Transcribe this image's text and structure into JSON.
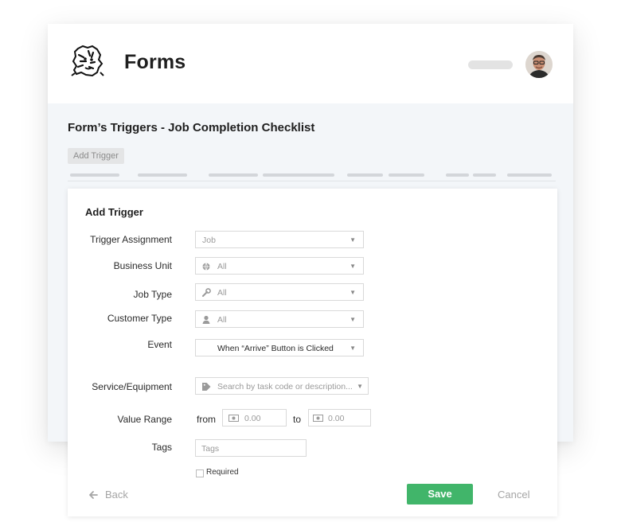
{
  "header": {
    "app_title": "Forms",
    "logo_icon": "tiger-mascot-logo",
    "avatar_icon": "user-avatar"
  },
  "page": {
    "title": "Form’s Triggers - Job Completion Checklist",
    "add_trigger_tag": "Add Trigger"
  },
  "panel": {
    "title": "Add Trigger",
    "fields": {
      "trigger_assignment": {
        "label": "Trigger Assignment",
        "value": "Job"
      },
      "business_unit": {
        "label": "Business Unit",
        "value": "All",
        "icon": "globe-icon"
      },
      "job_type": {
        "label": "Job Type",
        "value": "All",
        "icon": "wrench-icon"
      },
      "customer_type": {
        "label": "Customer Type",
        "value": "All",
        "icon": "person-icon"
      },
      "event": {
        "label": "Event",
        "value": "When “Arrive” Button is Clicked"
      },
      "service_equipment": {
        "label": "Service/Equipment",
        "placeholder": "Search by task code or description...",
        "icon": "tag-icon"
      },
      "value_range": {
        "label": "Value Range",
        "from_label": "from",
        "to_label": "to",
        "from_placeholder": "0.00",
        "to_placeholder": "0.00",
        "icon": "money-icon"
      },
      "tags": {
        "label": "Tags",
        "placeholder": "Tags"
      },
      "required": {
        "label": "Required",
        "checked": false
      }
    },
    "actions": {
      "back": "Back",
      "save": "Save",
      "cancel": "Cancel"
    }
  },
  "colors": {
    "primary": "#41b56a",
    "muted_text": "#a5a5a5",
    "page_bg": "#f3f6f9"
  }
}
